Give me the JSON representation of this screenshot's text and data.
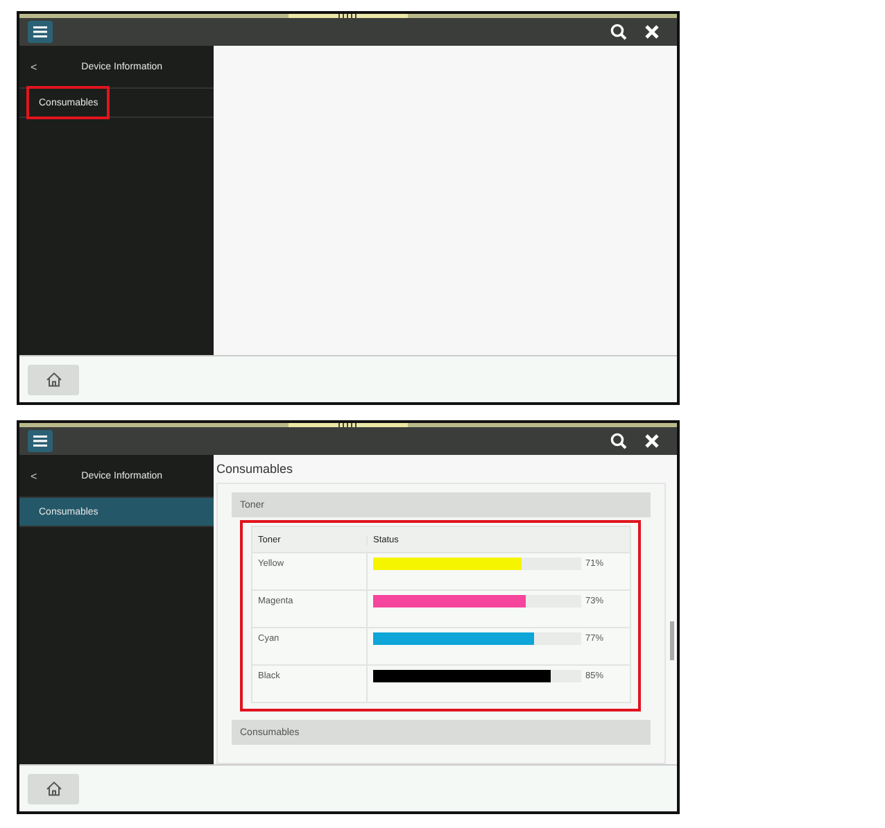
{
  "screens": [
    {
      "sidebar": {
        "back": "<",
        "title": "Device Information",
        "items": [
          {
            "label": "Consumables",
            "selected": false,
            "annotated": true
          }
        ]
      }
    },
    {
      "sidebar": {
        "back": "<",
        "title": "Device Information",
        "items": [
          {
            "label": "Consumables",
            "selected": true,
            "annotated": false
          }
        ]
      },
      "content": {
        "title": "Consumables",
        "sections": [
          {
            "label": "Toner",
            "table": {
              "annotated": true,
              "columns": [
                "Toner",
                "Status"
              ],
              "rows": [
                {
                  "name": "Yellow",
                  "level": 0.71,
                  "reading": "71%",
                  "color": "#f5f500"
                },
                {
                  "name": "Magenta",
                  "level": 0.73,
                  "reading": "73%",
                  "color": "#f5459c"
                },
                {
                  "name": "Cyan",
                  "level": 0.77,
                  "reading": "77%",
                  "color": "#0ea5d8"
                },
                {
                  "name": "Black",
                  "level": 0.85,
                  "reading": "85%",
                  "color": "#000000"
                }
              ]
            }
          },
          {
            "label": "Consumables"
          }
        ]
      }
    }
  ]
}
